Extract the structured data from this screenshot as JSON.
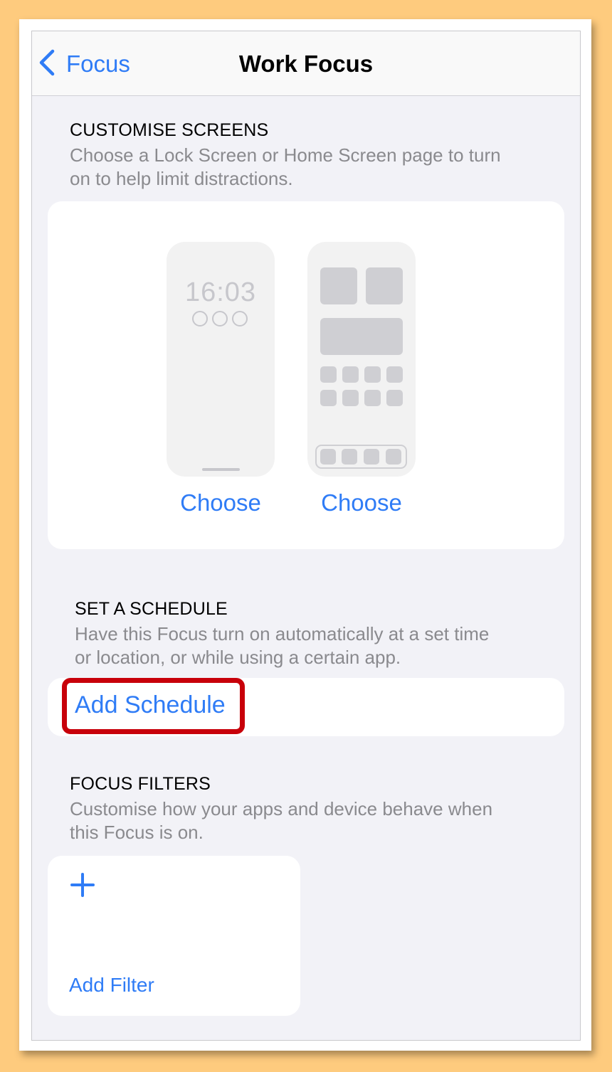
{
  "nav": {
    "back_label": "Focus",
    "title": "Work Focus"
  },
  "customise": {
    "title": "CUSTOMISE SCREENS",
    "description_line1": "Choose a Lock Screen or Home Screen page to turn",
    "description_line2": "on to help limit distractions.",
    "lock_preview_time": "16:03",
    "lock_choose_label": "Choose",
    "home_choose_label": "Choose"
  },
  "schedule": {
    "title": "SET A SCHEDULE",
    "description_line1": "Have this Focus turn on automatically at a set time",
    "description_line2": "or location, or while using a certain app.",
    "add_label": "Add Schedule"
  },
  "filters": {
    "title": "FOCUS FILTERS",
    "description_line1": "Customise how your apps and device behave when",
    "description_line2": "this Focus is on.",
    "add_label": "Add Filter"
  },
  "colors": {
    "accent": "#2f7cf6",
    "highlight": "#c8000a",
    "background": "#fecb7e"
  },
  "icons": [
    "chevron-left-icon",
    "plus-icon"
  ]
}
